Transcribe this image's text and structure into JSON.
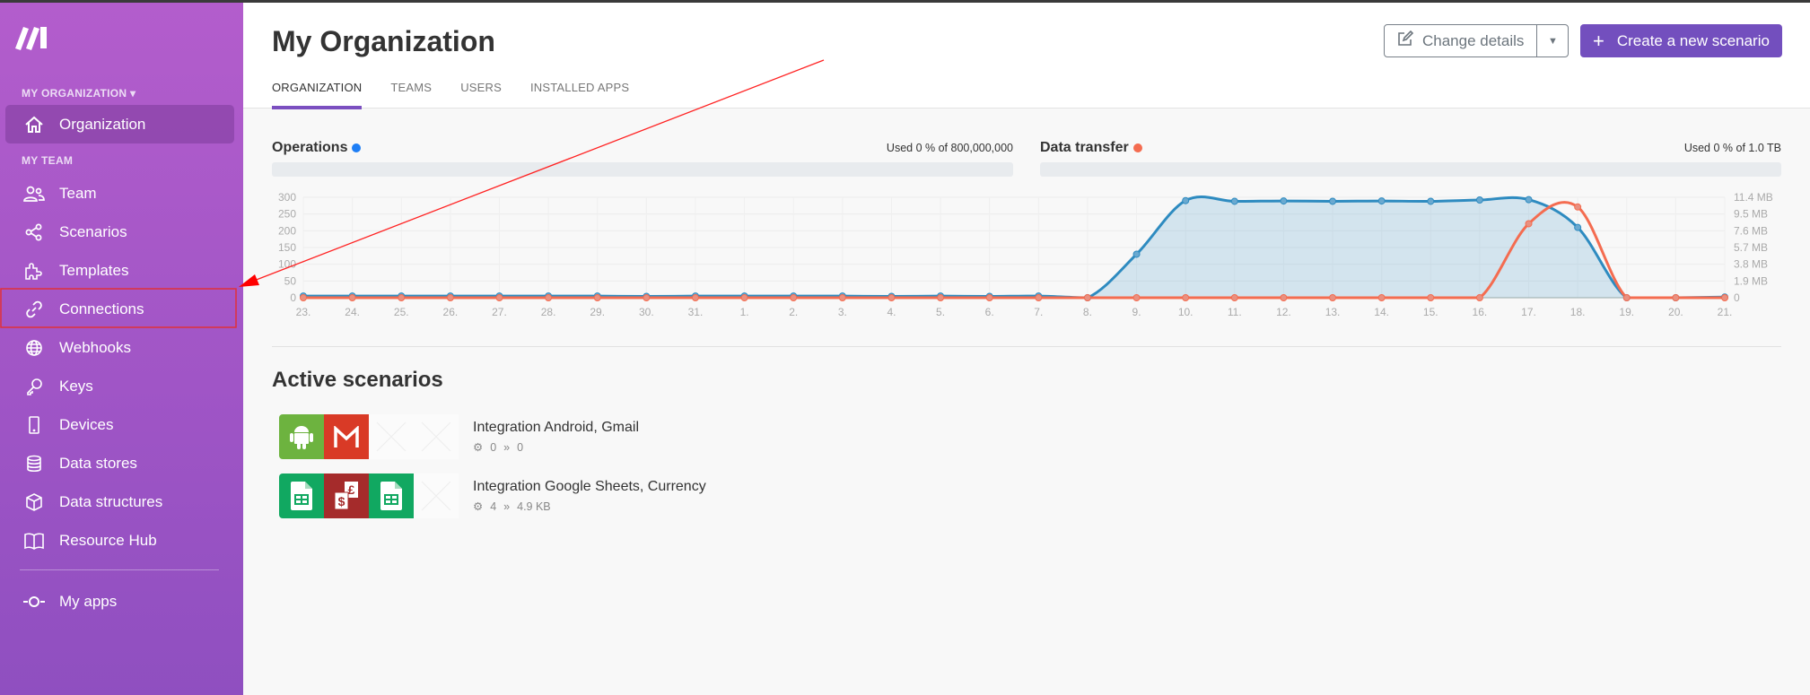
{
  "app": {
    "brand": "Make"
  },
  "colors": {
    "accent": "#734fbe",
    "operations": "#2e8bc0",
    "data_transfer": "#f46c50",
    "ops_dot": "#1e7ef5",
    "transfer_dot": "#f46c50"
  },
  "sidebar": {
    "org_section": "MY ORGANIZATION",
    "org_item": {
      "label": "Organization",
      "icon": "home-icon"
    },
    "team_section": "MY TEAM",
    "items": [
      {
        "label": "Team",
        "icon": "users-icon"
      },
      {
        "label": "Scenarios",
        "icon": "share-icon"
      },
      {
        "label": "Templates",
        "icon": "puzzle-icon"
      },
      {
        "label": "Connections",
        "icon": "link-icon"
      },
      {
        "label": "Webhooks",
        "icon": "globe-icon"
      },
      {
        "label": "Keys",
        "icon": "key-icon"
      },
      {
        "label": "Devices",
        "icon": "phone-icon"
      },
      {
        "label": "Data stores",
        "icon": "database-icon"
      },
      {
        "label": "Data structures",
        "icon": "cube-icon"
      },
      {
        "label": "Resource Hub",
        "icon": "book-icon"
      }
    ],
    "my_apps": {
      "label": "My apps",
      "icon": "apps-icon"
    }
  },
  "header": {
    "title": "My Organization",
    "tabs": [
      {
        "label": "ORGANIZATION",
        "active": true
      },
      {
        "label": "TEAMS"
      },
      {
        "label": "USERS"
      },
      {
        "label": "INSTALLED APPS"
      }
    ],
    "change_details": "Change details",
    "create": "Create a new scenario"
  },
  "usage": {
    "operations": {
      "label": "Operations",
      "used": "Used 0 % of 800,000,000",
      "percent": 0
    },
    "transfer": {
      "label": "Data transfer",
      "used": "Used 0 % of 1.0 TB",
      "percent": 0
    }
  },
  "chart_data": {
    "type": "area",
    "categories": [
      "23.",
      "24.",
      "25.",
      "26.",
      "27.",
      "28.",
      "29.",
      "30.",
      "31.",
      "1.",
      "2.",
      "3.",
      "4.",
      "5.",
      "6.",
      "7.",
      "8.",
      "9.",
      "10.",
      "11.",
      "12.",
      "13.",
      "14.",
      "15.",
      "16.",
      "17.",
      "18.",
      "19.",
      "20.",
      "21."
    ],
    "left_axis": {
      "ticks": [
        "0",
        "50",
        "100",
        "150",
        "200",
        "250",
        "300"
      ],
      "range": [
        0,
        300
      ]
    },
    "right_axis": {
      "ticks": [
        "0",
        "1.9 MB",
        "3.8 MB",
        "5.7 MB",
        "7.6 MB",
        "9.5 MB",
        "11.4 MB"
      ],
      "range_mb": [
        0,
        11.4
      ]
    },
    "grid": true,
    "series": [
      {
        "axis": "left",
        "style": "area",
        "values": [
          5,
          5,
          5,
          5,
          5,
          5,
          5,
          4,
          5,
          5,
          5,
          5,
          4,
          5,
          4,
          5,
          0,
          130,
          290,
          288,
          289,
          288,
          289,
          288,
          292,
          293,
          210,
          0,
          0,
          2
        ]
      },
      {
        "axis": "right",
        "style": "line",
        "unit": "MB",
        "values": [
          0,
          0,
          0,
          0,
          0,
          0,
          0,
          0,
          0,
          0,
          0,
          0,
          0,
          0,
          0,
          0,
          0,
          0,
          0,
          0,
          0,
          0,
          0,
          0,
          0,
          8.4,
          10.3,
          0,
          0,
          0
        ]
      }
    ]
  },
  "active": {
    "title": "Active scenarios",
    "scenarios": [
      {
        "name": "Integration Android, Gmail",
        "ops": "0",
        "transfer": "0",
        "apps": [
          {
            "icon": "android-icon",
            "color": "#6db33f"
          },
          {
            "icon": "gmail-icon",
            "color": "#d93a26"
          }
        ]
      },
      {
        "name": "Integration Google Sheets, Currency",
        "ops": "4",
        "transfer": "4.9 KB",
        "apps": [
          {
            "icon": "google-sheets-icon",
            "color": "#11a861"
          },
          {
            "icon": "currency-icon",
            "color": "#a52b2b"
          },
          {
            "icon": "google-sheets-icon",
            "color": "#11a861"
          }
        ]
      }
    ]
  }
}
